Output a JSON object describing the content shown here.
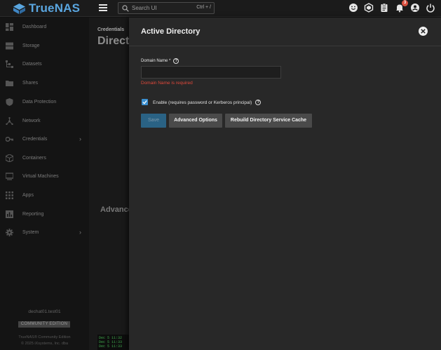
{
  "app": {
    "brand": "TrueNAS",
    "search_placeholder": "Search UI",
    "search_shortcut": "Ctrl + /",
    "notification_count": "3"
  },
  "sidebar": {
    "items": [
      {
        "label": "Dashboard",
        "icon": "dashboard-icon"
      },
      {
        "label": "Storage",
        "icon": "storage-icon"
      },
      {
        "label": "Datasets",
        "icon": "datasets-icon"
      },
      {
        "label": "Shares",
        "icon": "shares-icon"
      },
      {
        "label": "Data Protection",
        "icon": "shield-icon"
      },
      {
        "label": "Network",
        "icon": "network-icon"
      },
      {
        "label": "Credentials",
        "icon": "key-icon",
        "chevron": "›"
      },
      {
        "label": "Containers",
        "icon": "cube-icon"
      },
      {
        "label": "Virtual Machines",
        "icon": "monitor-icon"
      },
      {
        "label": "Apps",
        "icon": "apps-grid-icon"
      },
      {
        "label": "Reporting",
        "icon": "reporting-icon"
      },
      {
        "label": "System",
        "icon": "gear-icon",
        "chevron": "›"
      }
    ],
    "hostname": "dechat01.test01",
    "edition_badge": "COMMUNITY EDITION",
    "footer_line1": "TrueNAS® Community Edition",
    "footer_line2": "© 2025 iXsystems, Inc. dba"
  },
  "background": {
    "breadcrumb": "Credentials",
    "page_title": "Direct",
    "section_title": "Advance",
    "terminal_lines": [
      "Dec  5 11:32",
      "Dec  5 11:33",
      "Dec  5 11:33"
    ]
  },
  "panel": {
    "title": "Active Directory",
    "domain_label": "Domain Name *",
    "domain_value": "",
    "domain_error": "Domain Name is required",
    "enable_label": "Enable (requires password or Kerberos principal)",
    "enable_checked": true,
    "save_label": "Save",
    "advanced_label": "Advanced Options",
    "rebuild_label": "Rebuild Directory Service Cache"
  },
  "colors": {
    "brand": "#5aa6e0",
    "accent": "#3b8fd0",
    "error": "#e0493b",
    "badge": "#d9503f"
  }
}
